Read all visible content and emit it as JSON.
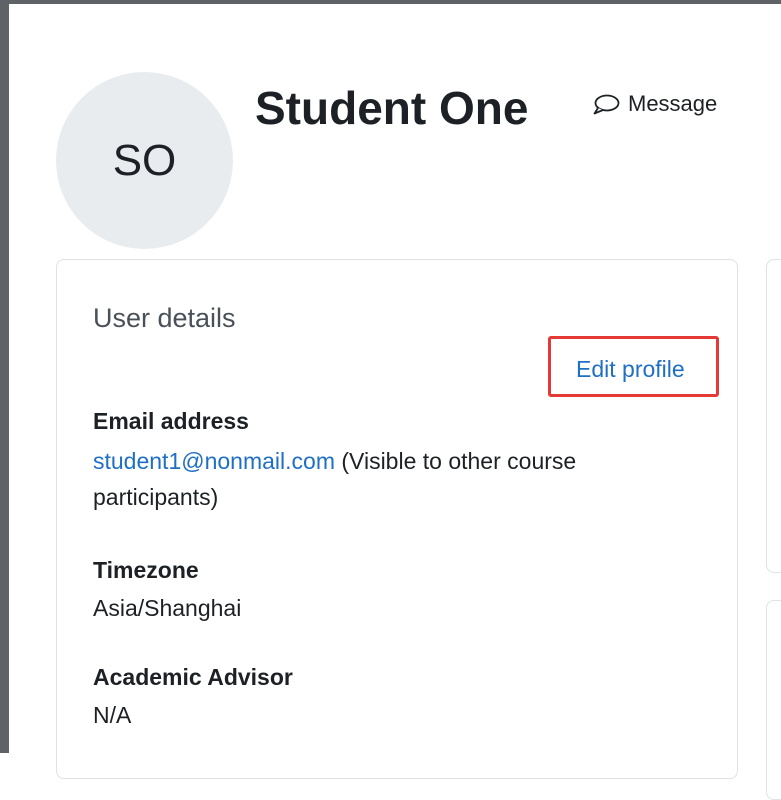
{
  "user": {
    "initials": "SO",
    "name": "Student One"
  },
  "header": {
    "message_label": "Message"
  },
  "user_details": {
    "title": "User details",
    "edit_label": "Edit profile",
    "email_label": "Email address",
    "email_value": "student1@nonmail.com",
    "email_note_line1": " (Visible to other course",
    "email_note_line2": "participants)",
    "timezone_label": "Timezone",
    "timezone_value": "Asia/Shanghai",
    "advisor_label": "Academic Advisor",
    "advisor_value": "N/A"
  },
  "icons": {
    "message": "speech-bubble-icon"
  },
  "colors": {
    "link": "#1f6fc5",
    "highlight_box": "#e53935",
    "avatar_bg": "#e9ecef",
    "frame": "#5f6368"
  }
}
